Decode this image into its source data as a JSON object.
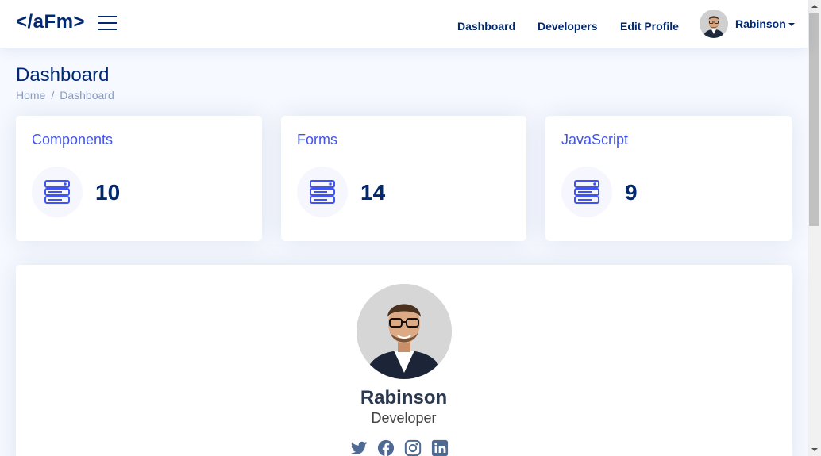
{
  "header": {
    "logo": "</aFm>",
    "nav": {
      "dashboard": "Dashboard",
      "developers": "Developers",
      "edit_profile": "Edit Profile"
    },
    "user_name": "Rabinson"
  },
  "page": {
    "title": "Dashboard",
    "breadcrumb": {
      "home": "Home",
      "separator": "/",
      "current": "Dashboard"
    }
  },
  "stats": [
    {
      "title": "Components",
      "value": "10",
      "icon": "server-icon"
    },
    {
      "title": "Forms",
      "value": "14",
      "icon": "server-icon"
    },
    {
      "title": "JavaScript",
      "value": "9",
      "icon": "server-icon"
    }
  ],
  "profile_card": {
    "name": "Rabinson",
    "role": "Developer",
    "socials": [
      "twitter-icon",
      "facebook-icon",
      "instagram-icon",
      "linkedin-icon"
    ]
  },
  "colors": {
    "primary": "#012970",
    "accent": "#4154f1",
    "muted": "#899bbd",
    "background": "#f6f9ff",
    "social": "#4f6a93"
  }
}
